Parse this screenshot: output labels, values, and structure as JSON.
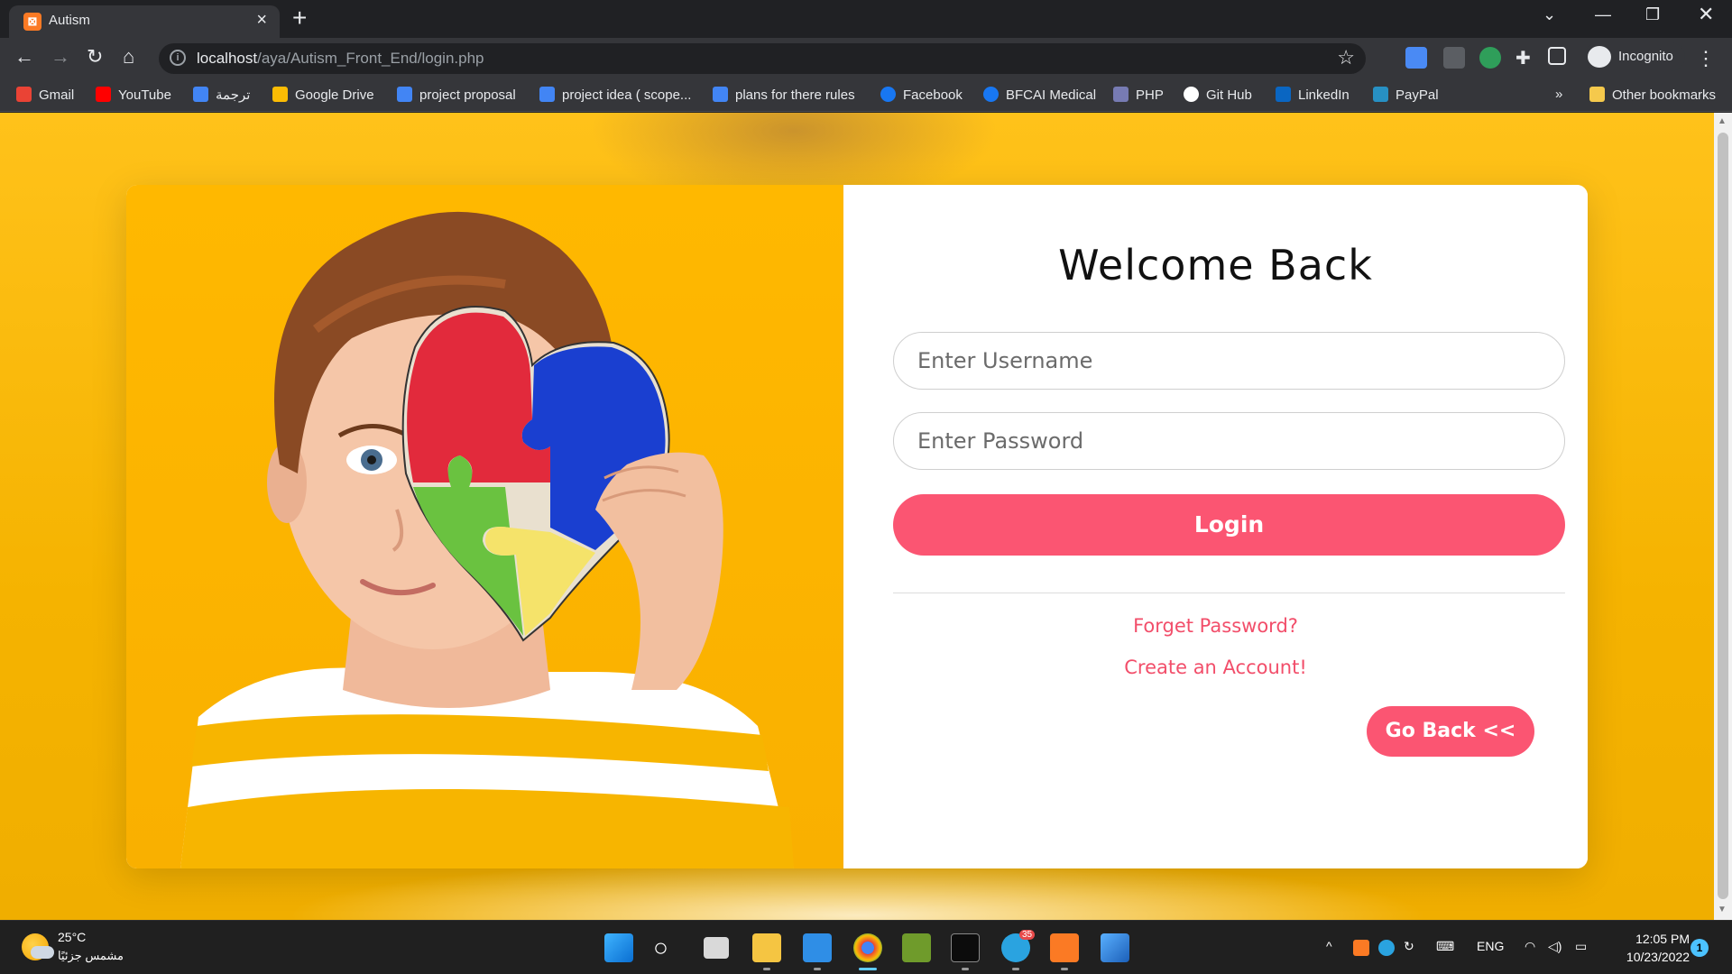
{
  "browser": {
    "tab_title": "Autism",
    "tab_favicon_letter": "⊠",
    "url_host": "localhost",
    "url_path": "/aya/Autism_Front_End/login.php",
    "profile_label": "Incognito",
    "bookmarks": [
      {
        "label": "Gmail",
        "icon": "gmail-icon",
        "color": "#ea4335"
      },
      {
        "label": "YouTube",
        "icon": "youtube-icon",
        "color": "#ff0000"
      },
      {
        "label": "ترجمة",
        "icon": "translate-icon",
        "color": "#4285f4"
      },
      {
        "label": "Google Drive",
        "icon": "drive-icon",
        "color": "#fbbc04"
      },
      {
        "label": "project proposal",
        "icon": "docs-icon",
        "color": "#4285f4"
      },
      {
        "label": "project idea ( scope...",
        "icon": "docs-icon",
        "color": "#4285f4"
      },
      {
        "label": "plans for there rules",
        "icon": "docs-icon",
        "color": "#4285f4"
      },
      {
        "label": "Facebook",
        "icon": "facebook-icon",
        "color": "#1877f2"
      },
      {
        "label": "BFCAI Medical",
        "icon": "facebook-icon",
        "color": "#1877f2"
      },
      {
        "label": "PHP",
        "icon": "php-icon",
        "color": "#777bb3"
      },
      {
        "label": "Git Hub",
        "icon": "github-icon",
        "color": "#ffffff"
      },
      {
        "label": "LinkedIn",
        "icon": "linkedin-icon",
        "color": "#0a66c2"
      },
      {
        "label": "PayPal",
        "icon": "paypal-icon",
        "color": "#003087"
      }
    ],
    "bookmarks_overflow": "»",
    "other_bookmarks": "Other bookmarks"
  },
  "login": {
    "heading": "Welcome Back",
    "username_placeholder": "Enter Username",
    "password_placeholder": "Enter Password",
    "login_label": "Login",
    "forgot_link": "Forget Password?",
    "create_link": "Create an Account!",
    "go_back_label": "Go Back <<"
  },
  "colors": {
    "accent": "#fb5572",
    "background": "#f6b400"
  },
  "taskbar": {
    "temperature": "25°C",
    "weather_desc": "مشمس جزئيًا",
    "language": "ENG",
    "time": "12:05 PM",
    "date": "10/23/2022",
    "notification_count": "1",
    "telegram_badge": "35"
  }
}
